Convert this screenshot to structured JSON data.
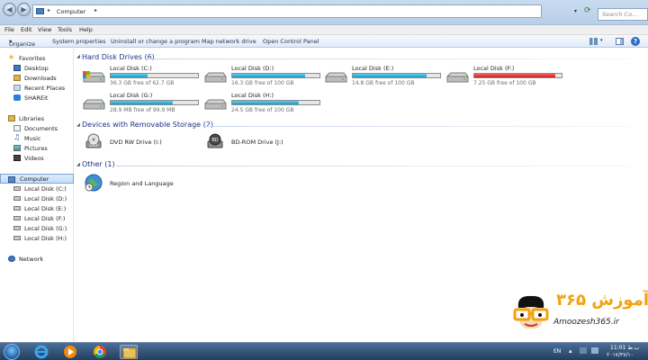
{
  "address": {
    "crumb": "Computer",
    "search_placeholder": "Search Co..."
  },
  "menu": [
    "File",
    "Edit",
    "View",
    "Tools",
    "Help"
  ],
  "toolbar": {
    "organize": "Organize",
    "system_properties": "System properties",
    "uninstall": "Uninstall or change a program",
    "map_drive": "Map network drive",
    "control_panel": "Open Control Panel"
  },
  "nav": {
    "favorites": "Favorites",
    "desktop": "Desktop",
    "downloads": "Downloads",
    "recent": "Recent Places",
    "shareit": "SHAREit",
    "libraries": "Libraries",
    "documents": "Documents",
    "music": "Music",
    "pictures": "Pictures",
    "videos": "Videos",
    "computer": "Computer",
    "disks": [
      "Local Disk (C:)",
      "Local Disk (D:)",
      "Local Disk (E:)",
      "Local Disk (F:)",
      "Local Disk (G:)",
      "Local Disk (H:)"
    ],
    "network": "Network"
  },
  "groups": {
    "hdd": "Hard Disk Drives (6)",
    "removable": "Devices with Removable Storage (2)",
    "other": "Other (1)"
  },
  "drives": [
    {
      "name": "Local Disk (C:)",
      "free": "36.3 GB free of 62.7 GB",
      "used": 0.42
    },
    {
      "name": "Local Disk (D:)",
      "free": "16.3 GB free of 100 GB",
      "used": 0.84
    },
    {
      "name": "Local Disk (E:)",
      "free": "14.8 GB free of 100 GB",
      "used": 0.85
    },
    {
      "name": "Local Disk (F:)",
      "free": "7.25 GB free of 100 GB",
      "used": 0.93
    },
    {
      "name": "Local Disk (G:)",
      "free": "28.9 MB free of 99.9 MB",
      "used": 0.71
    },
    {
      "name": "Local Disk (H:)",
      "free": "24.5 GB free of 100 GB",
      "used": 0.76
    }
  ],
  "removable": [
    {
      "name": "DVD RW Drive (I:)",
      "badge": "DVD"
    },
    {
      "name": "BD-ROM Drive (J:)",
      "badge": "BD"
    }
  ],
  "other": [
    {
      "name": "Region and Language"
    }
  ],
  "logo": {
    "persian": "آموزش ۳۶۵",
    "latin": "Amoozesh365.ir"
  },
  "tray": {
    "lang": "EN",
    "time": "11:01 ب.ظ",
    "date": "۲۰۱۷/۳۷/۱۰"
  },
  "colors": {
    "fill_normal": "#1d98c6",
    "fill_full": "#d11b1b",
    "group_header": "#1e3287"
  }
}
